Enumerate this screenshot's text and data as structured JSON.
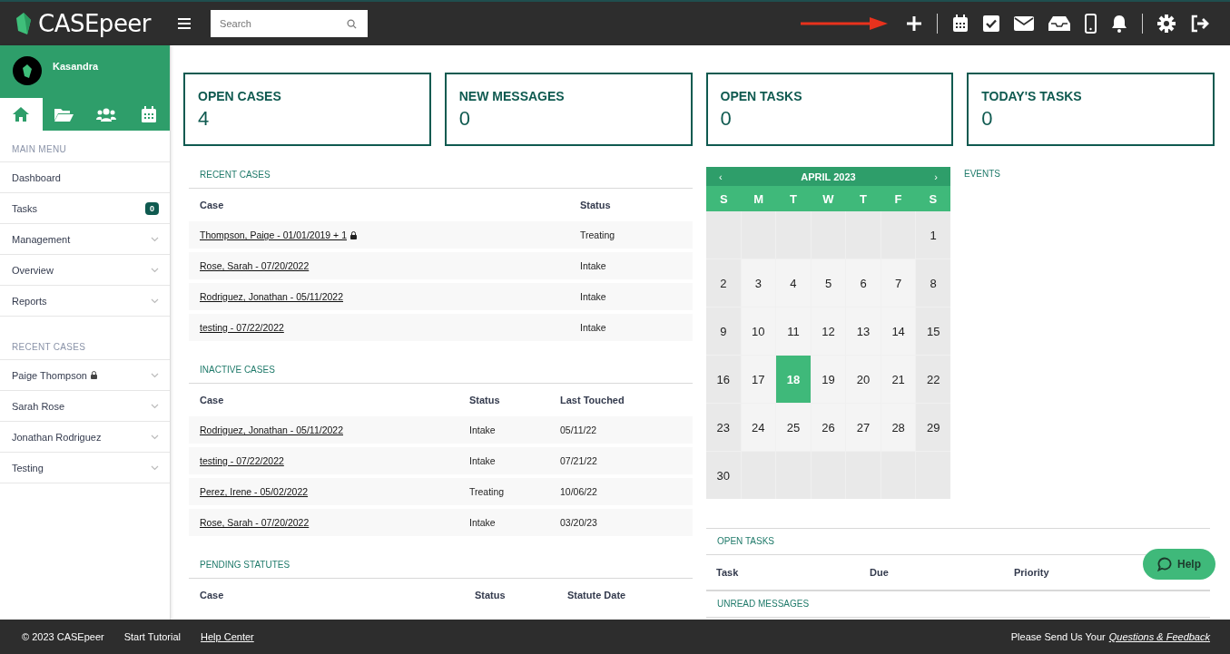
{
  "header": {
    "logo_text": "CASEpeer",
    "search": {
      "placeholder": "Search"
    },
    "annotation_arrow": true
  },
  "sidebar": {
    "user": "Kasandra",
    "tabs": [
      {
        "kind": "home",
        "selected": true
      },
      {
        "kind": "folder",
        "selected": false
      },
      {
        "kind": "users",
        "selected": false
      },
      {
        "kind": "calendar",
        "selected": false
      }
    ],
    "main_menu_title": "MAIN MENU",
    "main_menu": [
      {
        "label": "Dashboard",
        "expandable": false
      },
      {
        "label": "Tasks",
        "badge": "0",
        "expandable": false
      },
      {
        "label": "Management",
        "expandable": true
      },
      {
        "label": "Overview",
        "expandable": true
      },
      {
        "label": "Reports",
        "expandable": true
      }
    ],
    "recent_cases_title": "RECENT CASES",
    "recent_cases": [
      {
        "label": "Paige Thompson",
        "locked": true,
        "expandable": true
      },
      {
        "label": "Sarah Rose",
        "locked": false,
        "expandable": true
      },
      {
        "label": "Jonathan Rodriguez",
        "locked": false,
        "expandable": true
      },
      {
        "label": "Testing",
        "locked": false,
        "expandable": true
      }
    ]
  },
  "stats": [
    {
      "label": "OPEN CASES",
      "value": "4"
    },
    {
      "label": "NEW MESSAGES",
      "value": "0"
    },
    {
      "label": "OPEN TASKS",
      "value": "0"
    },
    {
      "label": "TODAY'S TASKS",
      "value": "0"
    }
  ],
  "tables": [
    {
      "title": "RECENT CASES",
      "columns": [
        "Case",
        "Status"
      ],
      "rows": [
        {
          "cells": [
            "Thompson, Paige - 01/01/2019 + 1",
            "Treating"
          ],
          "locked": true
        },
        {
          "cells": [
            "Rose, Sarah - 07/20/2022",
            "Intake"
          ],
          "locked": false
        },
        {
          "cells": [
            "Rodriguez, Jonathan - 05/11/2022",
            "Intake"
          ],
          "locked": false
        },
        {
          "cells": [
            "testing - 07/22/2022",
            "Intake"
          ],
          "locked": false
        }
      ]
    },
    {
      "title": "INACTIVE CASES",
      "columns": [
        "Case",
        "Status",
        "Last Touched"
      ],
      "rows": [
        {
          "cells": [
            "Rodriguez, Jonathan - 05/11/2022",
            "Intake",
            "05/11/22"
          ],
          "locked": false
        },
        {
          "cells": [
            "testing - 07/22/2022",
            "Intake",
            "07/21/22"
          ],
          "locked": false
        },
        {
          "cells": [
            "Perez, Irene - 05/02/2022",
            "Treating",
            "10/06/22"
          ],
          "locked": false
        },
        {
          "cells": [
            "Rose, Sarah - 07/20/2022",
            "Intake",
            "03/20/23"
          ],
          "locked": false
        }
      ]
    },
    {
      "title": "PENDING STATUTES",
      "columns": [
        "Case",
        "Status",
        "Statute Date"
      ]
    }
  ],
  "calendar": {
    "month": "APRIL 2023",
    "prev": "‹",
    "next": "›",
    "weekdays": [
      "S",
      "M",
      "T",
      "W",
      "T",
      "F",
      "S"
    ],
    "weeks": [
      [
        {
          "kind": "blank"
        },
        {
          "kind": "blank"
        },
        {
          "kind": "blank"
        },
        {
          "kind": "blank"
        },
        {
          "kind": "blank"
        },
        {
          "kind": "blank"
        },
        {
          "kind": "day",
          "day": "1",
          "selected": false
        }
      ],
      [
        {
          "kind": "day",
          "day": "2",
          "selected": false
        },
        {
          "kind": "day",
          "day": "3",
          "selected": false
        },
        {
          "kind": "day",
          "day": "4",
          "selected": false
        },
        {
          "kind": "day",
          "day": "5",
          "selected": false
        },
        {
          "kind": "day",
          "day": "6",
          "selected": false
        },
        {
          "kind": "day",
          "day": "7",
          "selected": false
        },
        {
          "kind": "day",
          "day": "8",
          "selected": false
        }
      ],
      [
        {
          "kind": "day",
          "day": "9",
          "selected": false
        },
        {
          "kind": "day",
          "day": "10",
          "selected": false
        },
        {
          "kind": "day",
          "day": "11",
          "selected": false
        },
        {
          "kind": "day",
          "day": "12",
          "selected": false
        },
        {
          "kind": "day",
          "day": "13",
          "selected": false
        },
        {
          "kind": "day",
          "day": "14",
          "selected": false
        },
        {
          "kind": "day",
          "day": "15",
          "selected": false
        }
      ],
      [
        {
          "kind": "day",
          "day": "16",
          "selected": false
        },
        {
          "kind": "day",
          "day": "17",
          "selected": false
        },
        {
          "kind": "day",
          "day": "18",
          "selected": true
        },
        {
          "kind": "day",
          "day": "19",
          "selected": false
        },
        {
          "kind": "day",
          "day": "20",
          "selected": false
        },
        {
          "kind": "day",
          "day": "21",
          "selected": false
        },
        {
          "kind": "day",
          "day": "22",
          "selected": false
        }
      ],
      [
        {
          "kind": "day",
          "day": "23",
          "selected": false
        },
        {
          "kind": "day",
          "day": "24",
          "selected": false
        },
        {
          "kind": "day",
          "day": "25",
          "selected": false
        },
        {
          "kind": "day",
          "day": "26",
          "selected": false
        },
        {
          "kind": "day",
          "day": "27",
          "selected": false
        },
        {
          "kind": "day",
          "day": "28",
          "selected": false
        },
        {
          "kind": "day",
          "day": "29",
          "selected": false
        }
      ],
      [
        {
          "kind": "day",
          "day": "30",
          "selected": false
        },
        {
          "kind": "blank"
        },
        {
          "kind": "blank"
        },
        {
          "kind": "blank"
        },
        {
          "kind": "blank"
        },
        {
          "kind": "blank"
        },
        {
          "kind": "blank"
        }
      ]
    ]
  },
  "events_title": "EVENTS",
  "open_tasks": {
    "title": "OPEN TASKS",
    "columns": [
      "Task",
      "Due",
      "Priority"
    ]
  },
  "unread_messages_title": "UNREAD MESSAGES",
  "help_button": "Help",
  "footer": {
    "copyright": "© 2023 CASEpeer",
    "tutorial": "Start Tutorial",
    "help_center": "Help Center",
    "feedback_prefix": "Please Send Us Your",
    "feedback_link": "Questions & Feedback"
  }
}
